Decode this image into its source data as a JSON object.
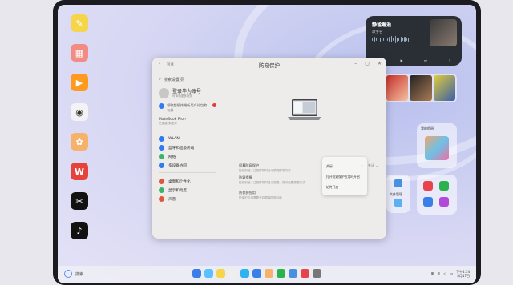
{
  "window": {
    "back_icon": "back-arrow-icon",
    "app_name": "设置",
    "title": "防窥保护",
    "controls": [
      "minimize-icon",
      "maximize-icon",
      "close-icon"
    ]
  },
  "sidebar": {
    "search_placeholder": "搜索设置项",
    "account": {
      "name": "登录华为账号",
      "sub": "可体验更多服务"
    },
    "promo": "领取超级终端新用户礼包和有券",
    "device": {
      "name": "MateBook Pro ›",
      "sub": "已连接 未配对"
    },
    "items": [
      {
        "label": "WLAN",
        "color": "#2f7bf5"
      },
      {
        "label": "蓝牙和超级终端",
        "color": "#2f7bf5"
      },
      {
        "label": "网络",
        "color": "#3bb36a"
      },
      {
        "label": "多设备协同",
        "color": "#2f7bf5"
      },
      {
        "label": "桌面和个性化",
        "color": "#e0583c"
      },
      {
        "label": "显示和亮度",
        "color": "#3bb36a"
      },
      {
        "label": "声音",
        "color": "#e0583c"
      }
    ]
  },
  "main": {
    "privacy_toggle": {
      "label": "屏幕防窥保护",
      "desc": "检测到他人注视屏幕时自动模糊屏幕内容"
    },
    "notify": {
      "label": "防窥提醒",
      "desc": "检测到他人注视屏幕时显示提醒，您可设置提醒方式"
    },
    "apps": {
      "label": "防保护应用",
      "desc": "防保护应用需要开启屏幕防窥功能"
    },
    "dropdown_value": "关闭"
  },
  "popup": {
    "options": [
      "关闭",
      "打开防窥保护应用时开启",
      "始终开启"
    ],
    "selected": "关闭"
  },
  "music": {
    "title": "静谧邂逅",
    "artist": "歌手名",
    "controls": [
      "previous-icon",
      "play-icon",
      "next-icon",
      "cast-icon"
    ]
  },
  "widgets": {
    "gallery_label": "我的相册",
    "files_label": "文件管理"
  },
  "taskbar": {
    "search_label": "搜索",
    "time": "下午4:54",
    "date": "8月17日"
  },
  "colors": {
    "accent": "#2f7bf5",
    "badge": "#e23b3b",
    "window_bg": "#edecea"
  }
}
